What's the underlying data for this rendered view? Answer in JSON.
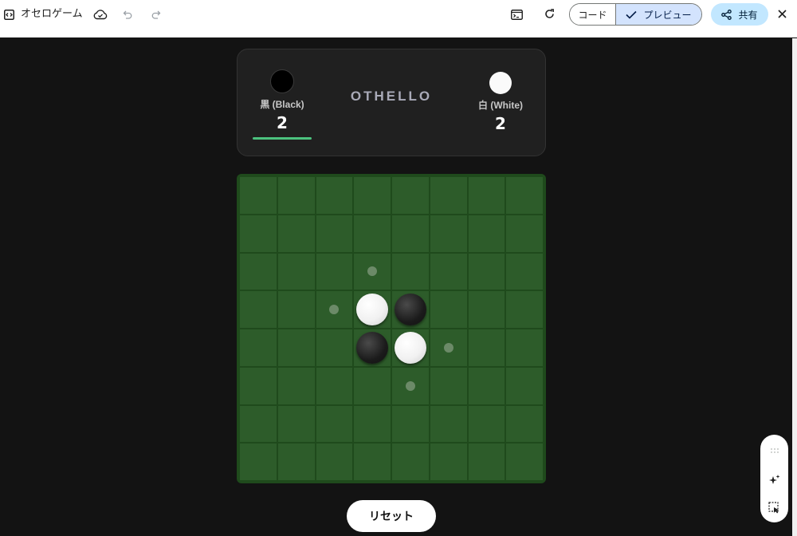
{
  "toolbar": {
    "title": "オセロゲーム",
    "code_label": "コード",
    "preview_label": "プレビュー",
    "share_label": "共有"
  },
  "game": {
    "title": "OTHELLO",
    "black": {
      "label": "黒 (Black)",
      "count": "2",
      "active_turn": true
    },
    "white": {
      "label": "白 (White)",
      "count": "2",
      "active_turn": false
    },
    "board": [
      [
        "",
        "",
        "",
        "",
        "",
        "",
        "",
        ""
      ],
      [
        "",
        "",
        "",
        "",
        "",
        "",
        "",
        ""
      ],
      [
        "",
        "",
        "",
        "hint",
        "",
        "",
        "",
        ""
      ],
      [
        "",
        "",
        "hint",
        "white",
        "black",
        "",
        "",
        ""
      ],
      [
        "",
        "",
        "",
        "black",
        "white",
        "hint",
        "",
        ""
      ],
      [
        "",
        "",
        "",
        "",
        "hint",
        "",
        "",
        ""
      ],
      [
        "",
        "",
        "",
        "",
        "",
        "",
        "",
        ""
      ],
      [
        "",
        "",
        "",
        "",
        "",
        "",
        "",
        ""
      ]
    ],
    "reset_label": "リセット"
  },
  "colors": {
    "board_green": "#2d5c2a",
    "turn_indicator": "#4cc27e"
  },
  "icons": {
    "toolbar": [
      "code-icon",
      "cloud-icon",
      "undo-icon",
      "redo-icon",
      "terminal-icon",
      "refresh-icon",
      "check-icon",
      "share-icon",
      "close-icon"
    ],
    "floating": [
      "drag-handle-icon",
      "sparkle-icon",
      "select-element-icon"
    ]
  }
}
